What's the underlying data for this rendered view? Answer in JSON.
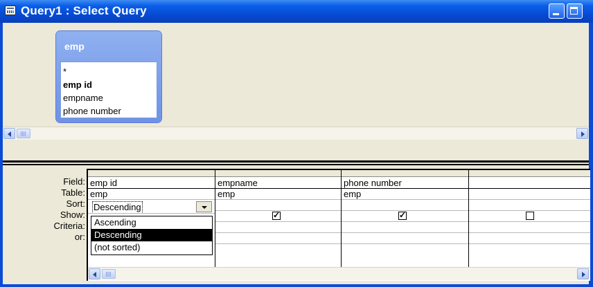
{
  "window": {
    "title": "Query1 : Select Query",
    "buttons": [
      "minimize",
      "maximize"
    ]
  },
  "table_pane": {
    "table_name": "emp",
    "fields": [
      "*",
      "emp id",
      "empname",
      "phone number"
    ],
    "bold_field": "emp id"
  },
  "row_labels": [
    "Field:",
    "Table:",
    "Sort:",
    "Show:",
    "Criteria:",
    "or:"
  ],
  "columns": [
    {
      "field": "emp id",
      "table": "emp",
      "sort": "Descending",
      "show": true
    },
    {
      "field": "empname",
      "table": "emp",
      "sort": "",
      "show": true
    },
    {
      "field": "phone number",
      "table": "emp",
      "sort": "",
      "show": true
    },
    {
      "field": "",
      "table": "",
      "sort": "",
      "show": false
    }
  ],
  "sort_dropdown": {
    "current": "Descending",
    "options": [
      "Ascending",
      "Descending",
      "(not sorted)"
    ],
    "selected_index": 1
  },
  "icons": {
    "title": "query-icon",
    "scroll_left": "arrow-left-icon",
    "scroll_right": "arrow-right-icon",
    "dropdown": "chevron-down-icon"
  }
}
